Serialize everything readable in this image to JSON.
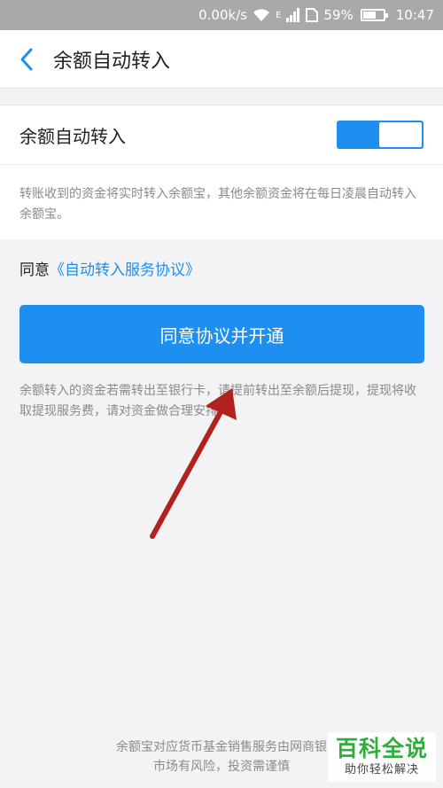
{
  "status_bar": {
    "speed": "0.00k/s",
    "network": "E",
    "battery": "59%",
    "time": "10:47"
  },
  "nav": {
    "title": "余额自动转入"
  },
  "toggle": {
    "label": "余额自动转入",
    "state": "on"
  },
  "description": "转账收到的资金将实时转入余额宝，其他余额资金将在每日凌晨自动转入余额宝。",
  "agreement": {
    "prefix": "同意",
    "link": "《自动转入服务协议》"
  },
  "button": {
    "label": "同意协议并开通"
  },
  "note": "余额转入的资金若需转出至银行卡，请提前转出至余额后提现，提现将收取提现服务费，请对资金做合理安排。",
  "footer": {
    "line1": "余额宝对应货币基金销售服务由网商银",
    "line2": "市场有风险，投资需谨慎"
  },
  "watermark": {
    "main": "百科全说",
    "sub": "助你轻松解决"
  },
  "colors": {
    "accent": "#1e8ff0",
    "arrow": "#b3211e",
    "watermark": "#2fae3e"
  }
}
